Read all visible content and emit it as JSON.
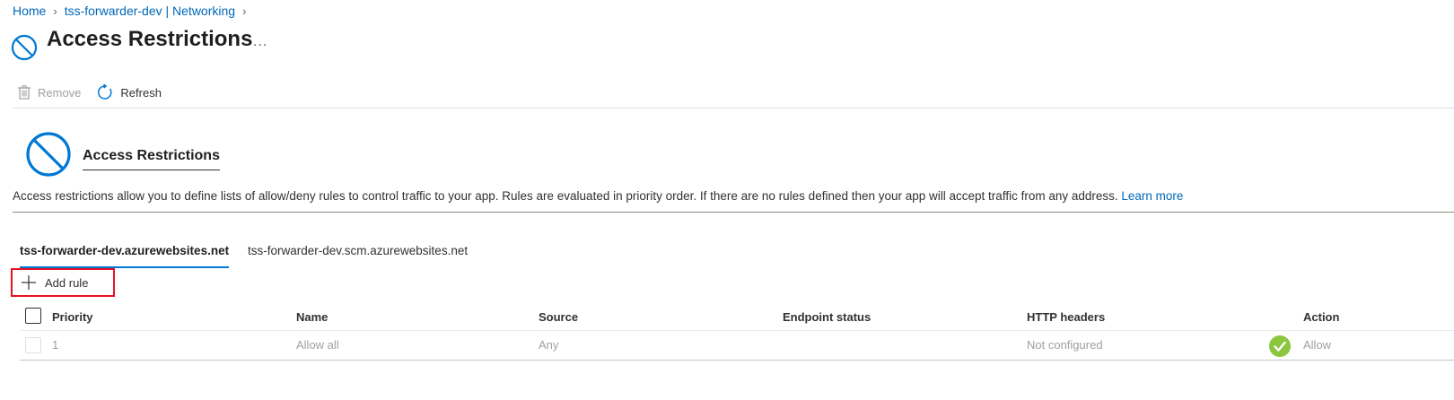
{
  "breadcrumb": {
    "home": "Home",
    "resource": "tss-forwarder-dev | Networking"
  },
  "page": {
    "title": "Access Restrictions",
    "more": "..."
  },
  "toolbar": {
    "remove": "Remove",
    "refresh": "Refresh"
  },
  "section": {
    "title": "Access Restrictions",
    "description": "Access restrictions allow you to define lists of allow/deny rules to control traffic to your app. Rules are evaluated in priority order. If there are no rules defined then your app will accept traffic from any address.",
    "learn_more": "Learn more"
  },
  "tabs": [
    {
      "label": "tss-forwarder-dev.azurewebsites.net",
      "active": true
    },
    {
      "label": "tss-forwarder-dev.scm.azurewebsites.net",
      "active": false
    }
  ],
  "add_rule": "Add rule",
  "table": {
    "columns": [
      "Priority",
      "Name",
      "Source",
      "Endpoint status",
      "HTTP headers",
      "Action"
    ],
    "rows": [
      {
        "priority": "1",
        "name": "Allow all",
        "source": "Any",
        "endpoint_status": "",
        "http_headers": "Not configured",
        "action": "Allow"
      }
    ]
  },
  "colors": {
    "accent": "#0078d4",
    "link": "#0067b8",
    "highlight_border": "#e81123",
    "allow_green": "#8cc63f"
  },
  "icons": {
    "title": "blocked-circle-icon",
    "remove": "trash-icon",
    "refresh": "refresh-icon",
    "add": "plus-icon",
    "allow": "check-circle-icon"
  }
}
